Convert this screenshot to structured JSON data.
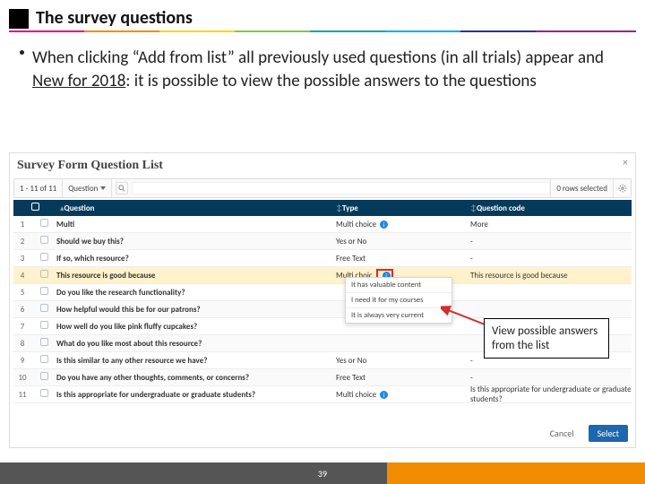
{
  "title": "The survey questions",
  "bullet": "When clicking “Add from list” all previously used questions (in all trials) appear and ",
  "bullet_new": "New for 2018",
  "bullet_rest": ": it is possible to view the possible answers to the questions",
  "shot": {
    "header": "Survey Form Question List",
    "close": "×",
    "pager": "1 - 11 of 11",
    "selector": "Question",
    "rows_selected": "0 rows selected",
    "thead": {
      "question": "Question",
      "type": "Type",
      "code": "Question code"
    }
  },
  "rows": [
    {
      "i": "1",
      "q": "Multi",
      "t": "Multi choice",
      "info": true,
      "c": "More"
    },
    {
      "i": "2",
      "q": "Should we buy this?",
      "t": "Yes or No",
      "c": "-"
    },
    {
      "i": "3",
      "q": "If so, which resource?",
      "t": "Free Text",
      "c": "-"
    },
    {
      "i": "4",
      "q": "This resource is good because",
      "t": "Multi choic",
      "info": false,
      "c": "This resource is good because",
      "hi": true,
      "red": true
    },
    {
      "i": "5",
      "q": "Do you like the research functionality?",
      "t": "",
      "c": ""
    },
    {
      "i": "6",
      "q": "How helpful would this be for our patrons?",
      "t": "",
      "c": ""
    },
    {
      "i": "7",
      "q": "How well do you like pink fluffy cupcakes?",
      "t": "",
      "c": ""
    },
    {
      "i": "8",
      "q": "What do you like most about this resource?",
      "t": "",
      "c": ""
    },
    {
      "i": "9",
      "q": "Is this similar to any other resource we have?",
      "t": "Yes or No",
      "c": "-"
    },
    {
      "i": "10",
      "q": "Do you have any other thoughts, comments, or concerns?",
      "t": "Free Text",
      "c": "-"
    },
    {
      "i": "11",
      "q": "Is this appropriate for undergraduate or graduate students?",
      "t": "Multi choice",
      "info": true,
      "c": "Is this appropriate for undergraduate or graduate students?"
    }
  ],
  "popover": [
    "It has valuable content",
    "I need it for my courses",
    "It is always very current"
  ],
  "callout": "View possible answers from the list",
  "buttons": {
    "cancel": "Cancel",
    "select": "Select"
  },
  "page_num": "39"
}
